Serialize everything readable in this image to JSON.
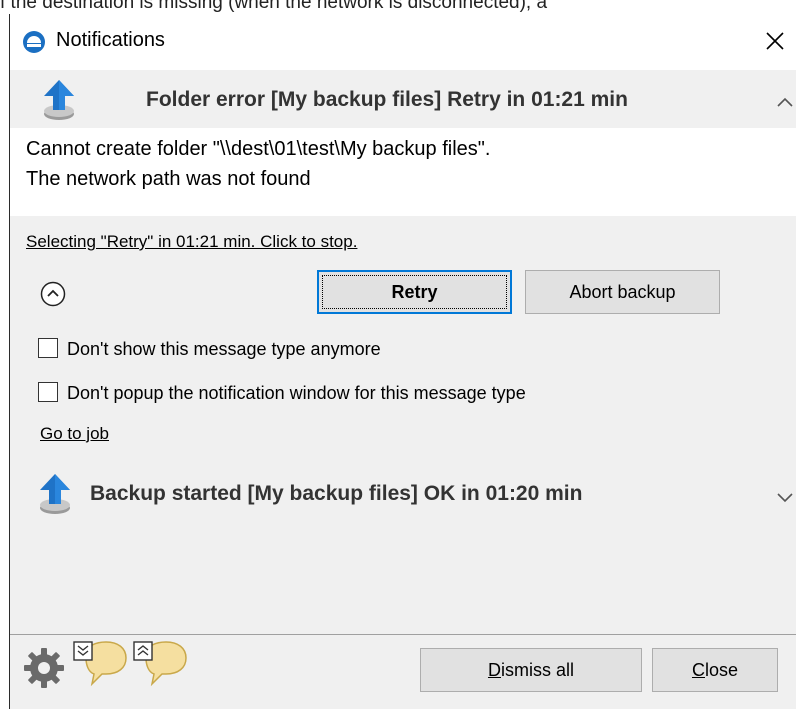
{
  "caption_cropped": "f the destination is missing (when the network is disconnected), a",
  "window": {
    "title": "Notifications"
  },
  "notification_expanded": {
    "title": "Folder error [My backup files] Retry in 01:21 min",
    "message_line1": "Cannot create folder \"\\\\dest\\01\\test\\My backup files\".",
    "message_line2": "The network path was not found",
    "auto_select_text": "Selecting \"Retry\" in 01:21 min. Click to stop.",
    "retry_label": "Retry",
    "abort_label": "Abort backup",
    "checkbox1_label": "Don't show this message type anymore",
    "checkbox2_label": "Don't popup the notification window for this message type",
    "checkbox1_checked": false,
    "checkbox2_checked": false,
    "goto_job_label": "Go to job"
  },
  "notification_collapsed": {
    "title": "Backup started [My backup files] OK in 01:20 min"
  },
  "footer": {
    "dismiss_first": "D",
    "dismiss_rest": "ismiss all",
    "close_first": "C",
    "close_rest": "lose"
  },
  "colors": {
    "accent_blue": "#0078d7",
    "app_icon_blue": "#1b6fc2",
    "upload_arrow_blue": "#1f73c7",
    "bubble_yellow": "#f5dfa0"
  },
  "icons": [
    "app-icon",
    "close-icon",
    "upload-icon",
    "chevron-up-icon",
    "chevron-down-icon",
    "circle-chevron-up-icon",
    "gear-icon",
    "expand-all-icon",
    "collapse-all-icon"
  ]
}
